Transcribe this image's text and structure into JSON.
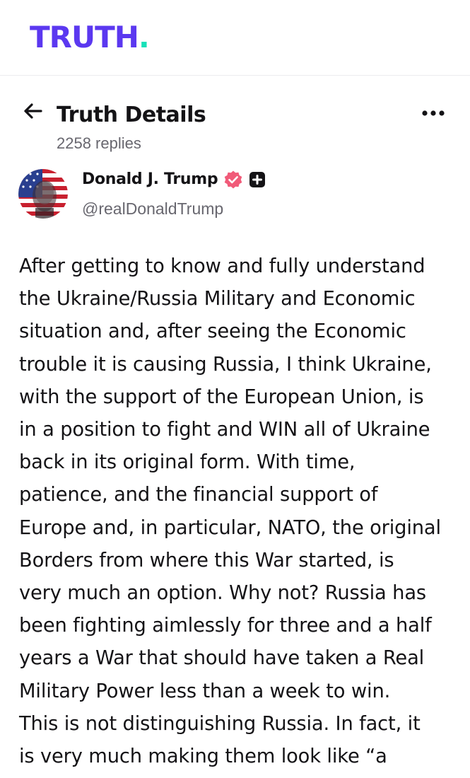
{
  "app": {
    "logo_text": "TRUTH",
    "logo_dot": ".",
    "colors": {
      "brand": "#5b38f0",
      "accent": "#17e1b8",
      "verified": "#f15b79"
    }
  },
  "header": {
    "title": "Truth Details",
    "replies": "2258 replies",
    "back_icon": "arrow-left-icon",
    "more_icon": "more-horizontal-icon"
  },
  "post": {
    "author_name": "Donald J. Trump",
    "handle": "@realDonaldTrump",
    "verified_icon": "verified-badge-icon",
    "plus_icon": "plus-badge-icon",
    "body": "After getting to know and fully understand\nthe Ukraine/Russia Military and Economic\nsituation and, after seeing the Economic\ntrouble it is causing Russia, I think Ukraine,\nwith the support of the European Union, is\nin a position to fight and WIN all of Ukraine\nback in its original form. With time,\npatience, and the financial support of\nEurope and, in particular, NATO, the original\nBorders from where this War started, is\nvery much an option. Why not? Russia has\nbeen fighting aimlessly for three and a half\nyears a War that should have taken a Real\nMilitary Power less than a week to win.\nThis is not distinguishing Russia. In fact, it\nis very much making them look like “a"
  }
}
